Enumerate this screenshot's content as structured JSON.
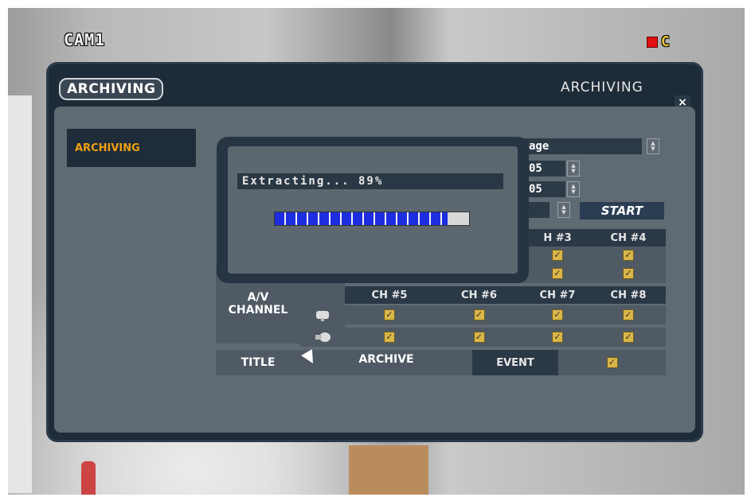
{
  "overlay": {
    "camera_label": "CAM1",
    "rec_indicator": "C",
    "colors": {
      "rec": "#e01010",
      "indicator_text": "#e8c23a"
    }
  },
  "window": {
    "tab_label": "ARCHIVING",
    "title": "ARCHIVING",
    "close_label": "×"
  },
  "sidebar": {
    "items": [
      {
        "label": "ARCHIVING"
      }
    ]
  },
  "form": {
    "storage_value": "age",
    "start_value": "05",
    "end_value": "05",
    "start_button": "START"
  },
  "channels": {
    "section_label": "A/V\nCHANNEL",
    "row1_headers": [
      "H #3",
      "CH #4"
    ],
    "row2_headers": [
      "CH #5",
      "CH #6",
      "CH #7",
      "CH #8"
    ],
    "checkmark": "✓"
  },
  "title_row": {
    "label": "TITLE",
    "value": "ARCHIVE",
    "event_label": "EVENT"
  },
  "dialog": {
    "status_text": "Extracting... 89%",
    "progress_percent": 89,
    "colors": {
      "progress_fill": "#1c2ee0"
    }
  }
}
